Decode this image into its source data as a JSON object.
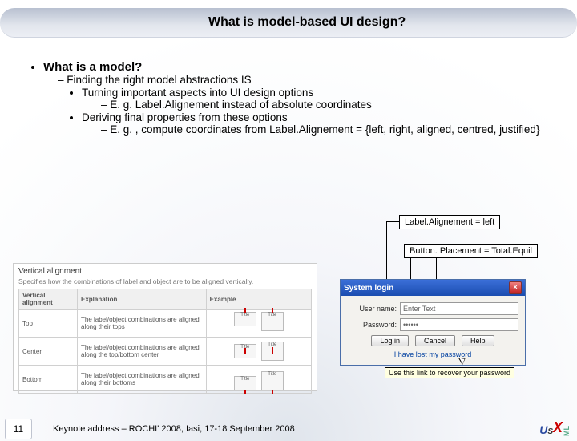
{
  "slide": {
    "title": "What is model-based UI design?",
    "bullet1": "What is a model?",
    "bullet2": "Finding the right model abstractions IS",
    "bullet3": "Turning important aspects into UI design options",
    "bullet3a": "E. g. Label.Alignement instead of absolute coordinates",
    "bullet4": "Deriving final properties from these options",
    "bullet4a": "E. g. , compute coordinates from Label.Alignement = {left, right, aligned, centred, justified}",
    "label_box1": "Label.Alignement = left",
    "label_box2": "Button. Placement = Total.Equil"
  },
  "valign": {
    "heading": "Vertical alignment",
    "desc": "Specifies how the combinations of label and object are to be aligned vertically.",
    "col1": "Vertical alignment",
    "col2": "Explanation",
    "col3": "Example",
    "rows": [
      {
        "name": "Top",
        "expl": "The label/object combinations are aligned along their tops"
      },
      {
        "name": "Center",
        "expl": "The label/object combinations are aligned along the top/bottom center"
      },
      {
        "name": "Bottom",
        "expl": "The label/object combinations are aligned along their bottoms"
      }
    ],
    "mini_label": "Title"
  },
  "login": {
    "title": "System login",
    "user_label": "User name:",
    "user_value": "Enter Text",
    "pass_label": "Password:",
    "pass_value": "••••••",
    "btn_login": "Log in",
    "btn_cancel": "Cancel",
    "btn_help": "Help",
    "link": "I have lost my password",
    "tooltip": "Use this link to recover your password"
  },
  "footer": {
    "page": "11",
    "note": "Keynote address – ROCHI' 2008, Iasi, 17-18 September 2008"
  },
  "logo": {
    "u": "U",
    "s": "S",
    "x": "X",
    "ml": "ML"
  }
}
